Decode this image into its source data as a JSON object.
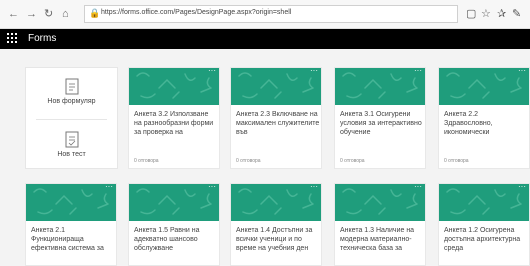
{
  "browser": {
    "url": "https://forms.office.com/Pages/DesignPage.aspx?origin=shell",
    "back_icon": "back-arrow-icon",
    "forward_icon": "forward-arrow-icon",
    "refresh_icon": "refresh-icon",
    "home_icon": "home-icon"
  },
  "app": {
    "name": "Forms"
  },
  "new_card": {
    "new_form_label": "Нов формуляр",
    "new_quiz_label": "Нов тест"
  },
  "forms": [
    {
      "title": "Анкета 3.2 Използване на разнообразни форми за проверка на",
      "responses": "0 отговора"
    },
    {
      "title": "Анкета 2.3 Включване на максимален служителите във",
      "responses": "0 отговора"
    },
    {
      "title": "Анкета 3.1 Осигурени условия за интерактивно обучение",
      "responses": "0 отговора"
    },
    {
      "title": "Анкета 2.2 Здравословно, икономически",
      "responses": "0 отговора"
    },
    {
      "title": "Анкета 2.1 Функционираща ефективна система за",
      "responses": ""
    },
    {
      "title": "Анкета 1.5 Равни на адекватно шансово обслужване",
      "responses": ""
    },
    {
      "title": "Анкета 1.4 Достъпни за всички ученици и по време на учебния ден",
      "responses": ""
    },
    {
      "title": "Анкета 1.3 Наличие на модерна материално-техническа база за",
      "responses": ""
    },
    {
      "title": "Анкета 1.2 Осигурена достъпна архитектурна среда",
      "responses": ""
    }
  ],
  "colors": {
    "thumb": "#1f9d7c",
    "appbar": "#000000"
  }
}
